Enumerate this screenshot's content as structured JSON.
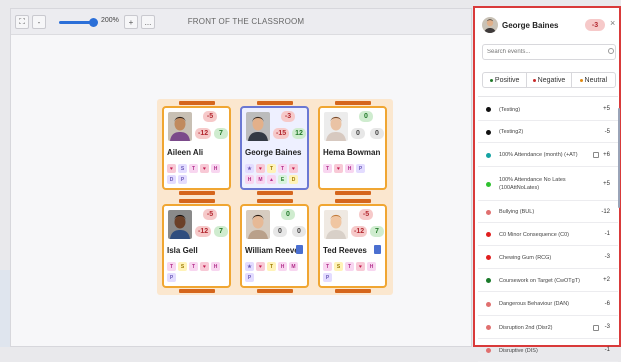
{
  "toolbar": {
    "expand_icon": "expand-icon",
    "zoom_out_label": "-",
    "zoom_in_label": "+",
    "more_label": "...",
    "zoom_level": "200%",
    "zoom_fraction": 0.85,
    "front_label": "FRONT OF THE CLASSROOM"
  },
  "colors": {
    "positive": "#237a2a",
    "negative": "#c92a2a",
    "neutral": "#e08a12",
    "selected_border": "#6b78d3",
    "card_border": "#f0a632",
    "panel_border": "#d93a3a"
  },
  "students": [
    {
      "name": "Aileen Ali",
      "total": "-5",
      "neg": "-12",
      "pos": "7",
      "has_doc": false,
      "badges": [
        [
          "♥",
          "#f8c9d6",
          "#c21a4d"
        ],
        [
          "S",
          "#e3dcff",
          "#6b5ab8"
        ],
        [
          "T",
          "#f8d6f0",
          "#b12f8b"
        ],
        [
          "♥",
          "#f8c9d6",
          "#c21a4d"
        ],
        [
          "H",
          "#f8d6f0",
          "#b12f8b"
        ],
        [
          "D",
          "#e3dcff",
          "#6b5ab8"
        ],
        [
          "P",
          "#e3dcff",
          "#6b5ab8"
        ]
      ]
    },
    {
      "name": "George Baines",
      "total": "-3",
      "neg": "-15",
      "pos": "12",
      "has_doc": false,
      "selected": true,
      "badges": [
        [
          "★",
          "#e3dcff",
          "#6b5ab8"
        ],
        [
          "♥",
          "#f8c9d6",
          "#c21a4d"
        ],
        [
          "T",
          "#fff3b8",
          "#9c7a00"
        ],
        [
          "T",
          "#f8d6f0",
          "#b12f8b"
        ],
        [
          "♥",
          "#f8c9d6",
          "#c21a4d"
        ],
        [
          "H",
          "#f8d6f0",
          "#b12f8b"
        ],
        [
          "M",
          "#f8d6f0",
          "#b12f8b"
        ],
        [
          "▲",
          "#f8d6f0",
          "#b12f8b"
        ],
        [
          "E",
          "#d8f3dc",
          "#237a2a"
        ],
        [
          "D",
          "#fff3b8",
          "#9c7a00"
        ]
      ]
    },
    {
      "name": "Hema Bowman",
      "total": "0",
      "neg": "0",
      "pos": "0",
      "has_doc": false,
      "badges": [
        [
          "T",
          "#f8d6f0",
          "#b12f8b"
        ],
        [
          "♥",
          "#f8c9d6",
          "#c21a4d"
        ],
        [
          "H",
          "#f8d6f0",
          "#b12f8b"
        ],
        [
          "P",
          "#e3dcff",
          "#6b5ab8"
        ]
      ]
    },
    {
      "name": "Isla Gell",
      "total": "-5",
      "neg": "-12",
      "pos": "7",
      "has_doc": false,
      "badges": [
        [
          "T",
          "#f8d6f0",
          "#b12f8b"
        ],
        [
          "S",
          "#fff3b8",
          "#9c7a00"
        ],
        [
          "T",
          "#f8d6f0",
          "#b12f8b"
        ],
        [
          "♥",
          "#f8c9d6",
          "#c21a4d"
        ],
        [
          "H",
          "#f8d6f0",
          "#b12f8b"
        ],
        [
          "P",
          "#e3dcff",
          "#6b5ab8"
        ]
      ]
    },
    {
      "name": "William Reeve",
      "total": "0",
      "neg": "0",
      "pos": "0",
      "has_doc": true,
      "badges": [
        [
          "★",
          "#e3dcff",
          "#6b5ab8"
        ],
        [
          "♥",
          "#f8c9d6",
          "#c21a4d"
        ],
        [
          "T",
          "#fff3b8",
          "#9c7a00"
        ],
        [
          "H",
          "#f8d6f0",
          "#b12f8b"
        ],
        [
          "M",
          "#f8d6f0",
          "#b12f8b"
        ],
        [
          "P",
          "#e3dcff",
          "#6b5ab8"
        ]
      ]
    },
    {
      "name": "Ted Reeves",
      "total": "-5",
      "neg": "-12",
      "pos": "7",
      "has_doc": true,
      "badges": [
        [
          "T",
          "#f8d6f0",
          "#b12f8b"
        ],
        [
          "S",
          "#fff3b8",
          "#9c7a00"
        ],
        [
          "T",
          "#f8d6f0",
          "#b12f8b"
        ],
        [
          "♥",
          "#f8c9d6",
          "#c21a4d"
        ],
        [
          "H",
          "#f8d6f0",
          "#b12f8b"
        ],
        [
          "P",
          "#e3dcff",
          "#6b5ab8"
        ]
      ]
    }
  ],
  "panel": {
    "name": "George Baines",
    "score": "-3",
    "close_icon": "×",
    "search_placeholder": "Search events...",
    "tabs": [
      {
        "label": "Positive",
        "color": "#237a2a"
      },
      {
        "label": "Negative",
        "color": "#c92a2a"
      },
      {
        "label": "Neutral",
        "color": "#e08a12"
      }
    ],
    "events": [
      {
        "label": "(Testing)",
        "score": "+5",
        "color": "#111111",
        "link": false
      },
      {
        "label": "(Testing2)",
        "score": "-5",
        "color": "#111111",
        "link": false
      },
      {
        "label": "100% Attendance (month) (+AT)",
        "score": "+6",
        "color": "#15a3a3",
        "link": true
      },
      {
        "label": "100% Attendance No Lates (100AttNoLates)",
        "score": "+5",
        "color": "#2fc12f",
        "link": false
      },
      {
        "label": "Bullying (BUL)",
        "score": "-12",
        "color": "#e0706f",
        "link": false
      },
      {
        "label": "C0 Minor Consequence (C0)",
        "score": "-1",
        "color": "#e01f1f",
        "link": false
      },
      {
        "label": "Chewing Gum (RCG)",
        "score": "-3",
        "color": "#e01f1f",
        "link": false
      },
      {
        "label": "Coursework on Target (CwOTgT)",
        "score": "+2",
        "color": "#1a7a2a",
        "link": false
      },
      {
        "label": "Dangerous Behaviour (DAN)",
        "score": "-6",
        "color": "#e0706f",
        "link": false
      },
      {
        "label": "Disruption 2nd (Disr2)",
        "score": "-3",
        "color": "#e0706f",
        "link": true
      },
      {
        "label": "Disruptive (DIS)",
        "score": "-1",
        "color": "#e0706f",
        "link": false
      }
    ]
  }
}
